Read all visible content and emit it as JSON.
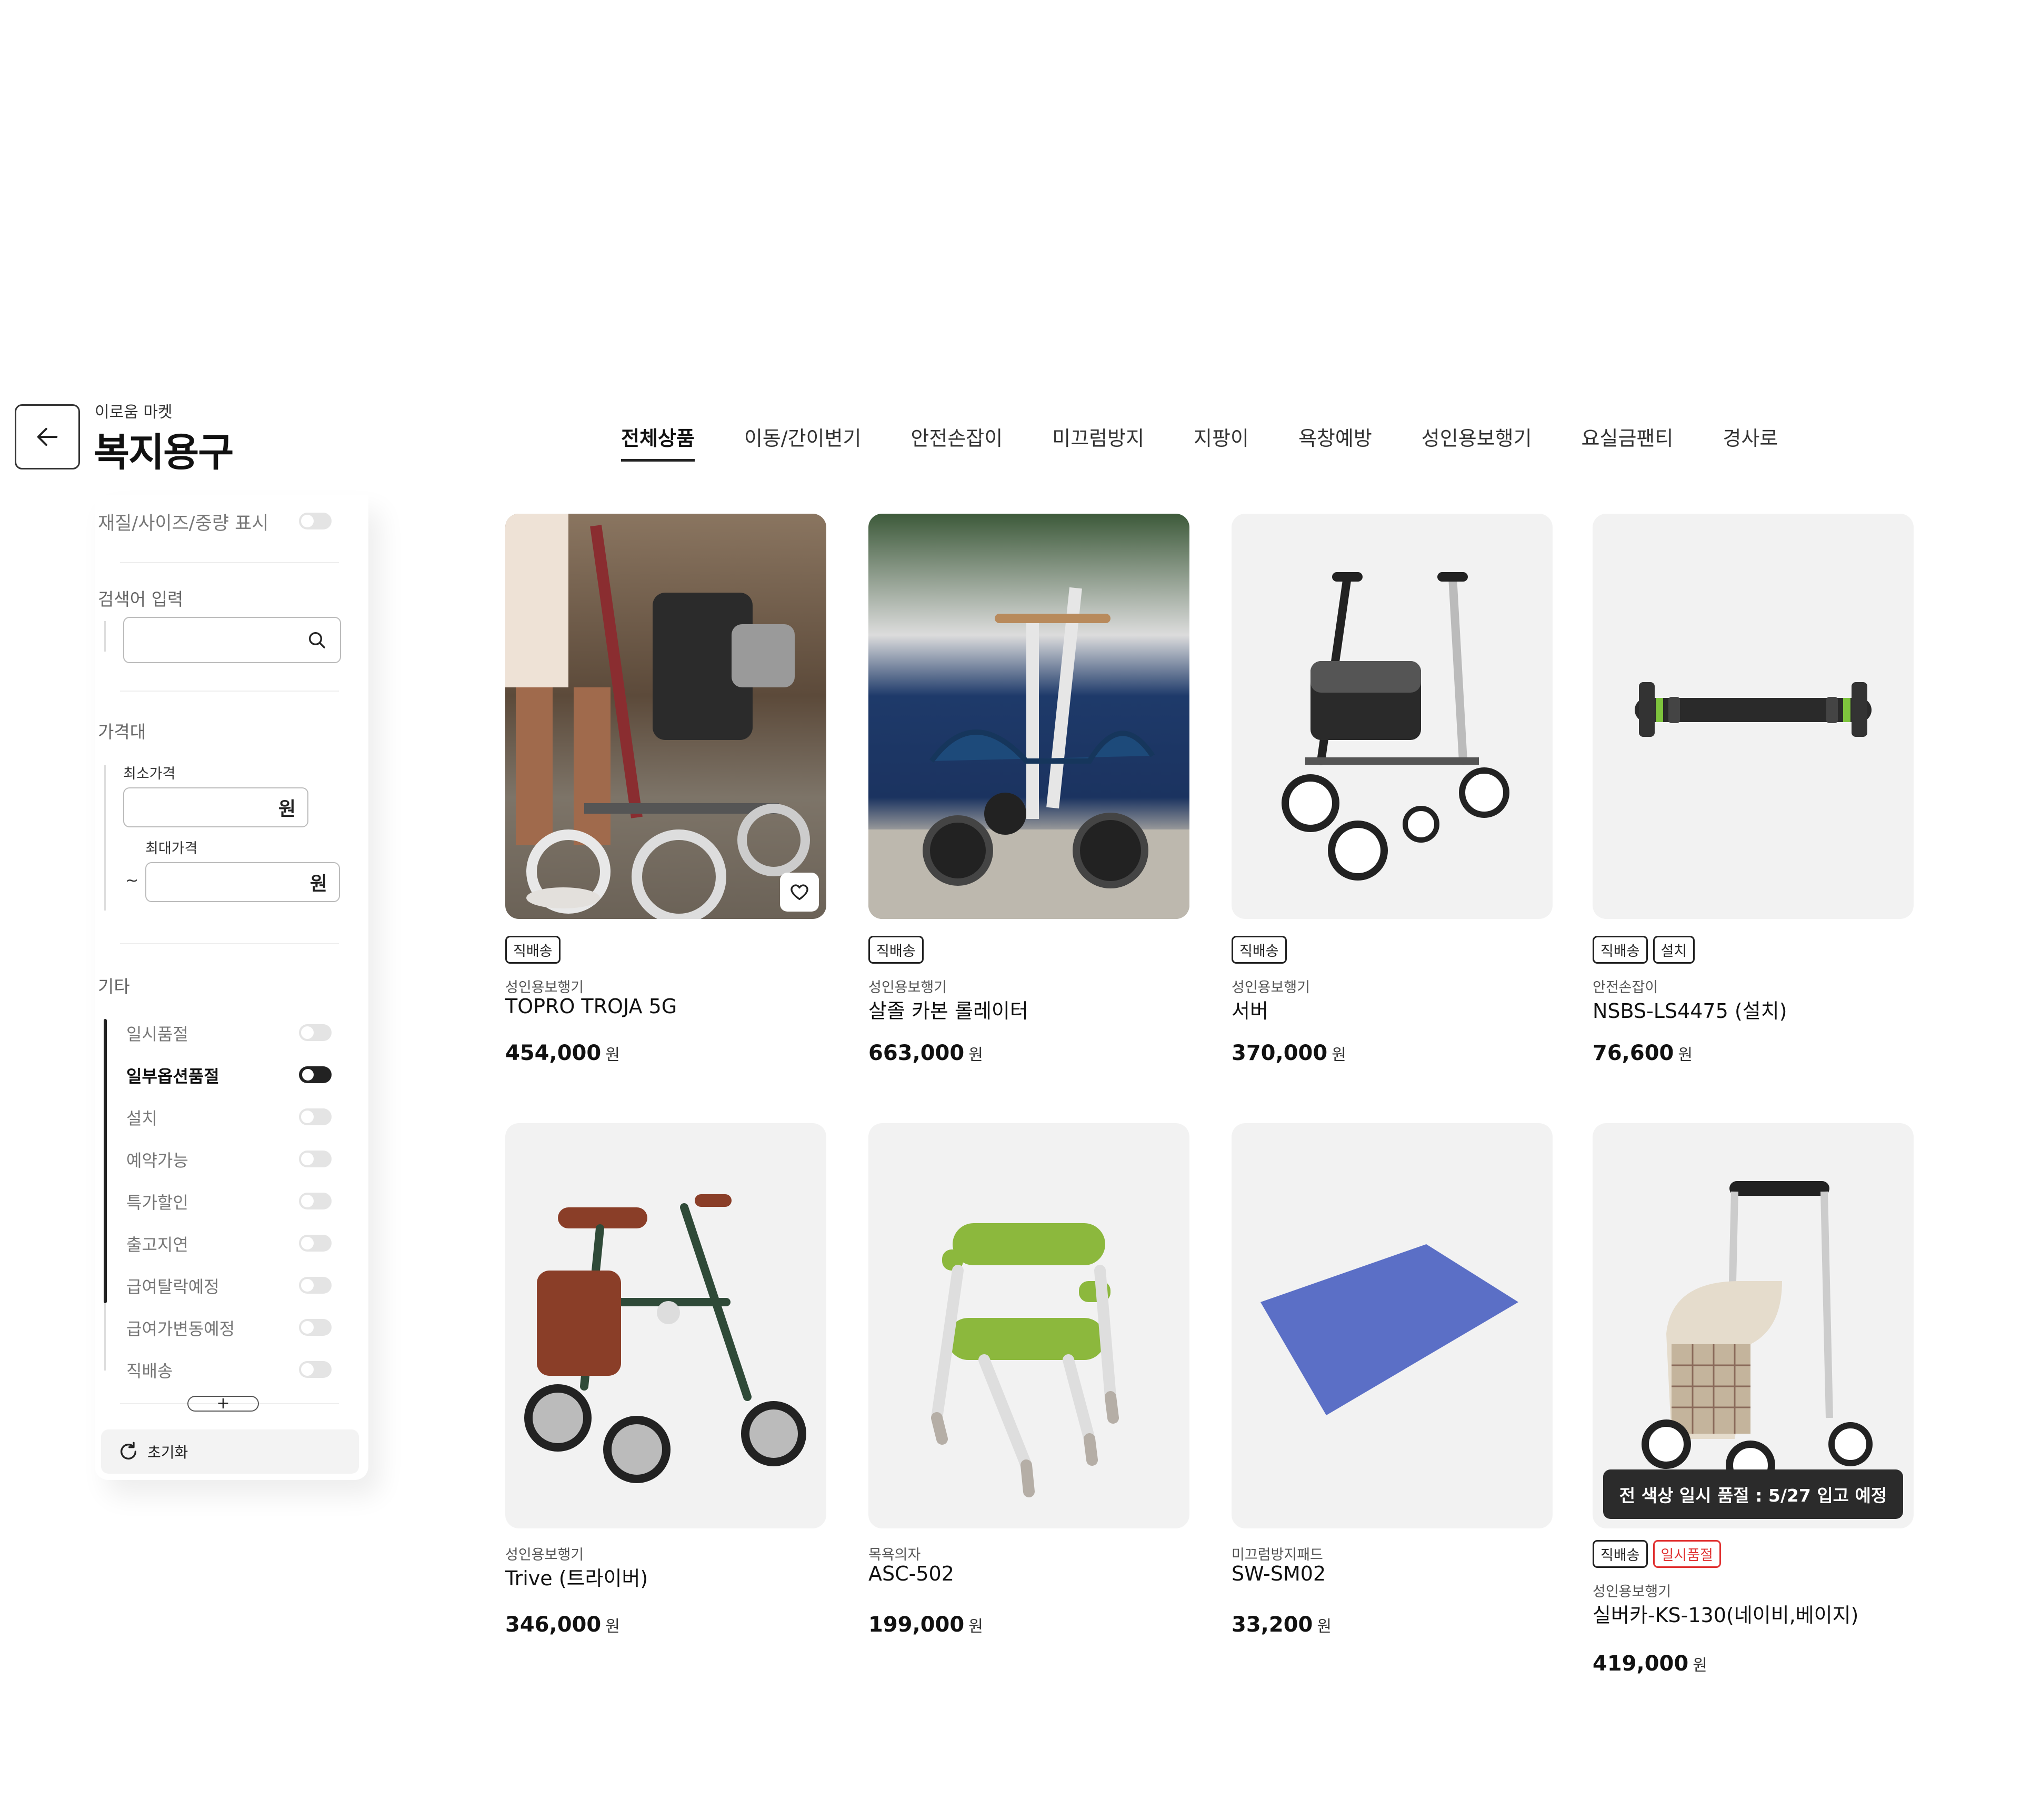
{
  "header": {
    "brand_sub": "이로움 마켓",
    "brand_title": "복지용구",
    "tabs": [
      "전체상품",
      "이동/간이변기",
      "안전손잡이",
      "미끄럼방지",
      "지팡이",
      "욕창예방",
      "성인용보행기",
      "요실금팬티",
      "경사로"
    ],
    "active_tab": "전체상품"
  },
  "sidebar": {
    "display_toggle_label": "재질/사이즈/중량 표시",
    "search": {
      "label": "검색어 입력",
      "value": "",
      "placeholder": ""
    },
    "price": {
      "label": "가격대",
      "min_label": "최소가격",
      "max_label": "최대가격",
      "unit": "원",
      "tilde": "~",
      "min_value": "",
      "max_value": ""
    },
    "etc": {
      "label": "기타",
      "items": [
        {
          "label": "일시품절",
          "on": false
        },
        {
          "label": "일부옵션품절",
          "on": true
        },
        {
          "label": "설치",
          "on": false
        },
        {
          "label": "예약가능",
          "on": false
        },
        {
          "label": "특가할인",
          "on": false
        },
        {
          "label": "출고지연",
          "on": false
        },
        {
          "label": "급여탈락예정",
          "on": false
        },
        {
          "label": "급여가변동예정",
          "on": false
        },
        {
          "label": "직배송",
          "on": false
        }
      ]
    },
    "more_label": "+",
    "reset_label": "초기화"
  },
  "products": [
    {
      "badges": [
        "직배송"
      ],
      "category": "성인용보행기",
      "name": "TOPRO TROJA 5G",
      "price": "454,000",
      "unit": "원",
      "image": "rollator-photo",
      "has_heart": true
    },
    {
      "badges": [
        "직배송"
      ],
      "category": "성인용보행기",
      "name": "살졸 카본 롤레이터",
      "price": "663,000",
      "unit": "원",
      "image": "rollator-blue-photo"
    },
    {
      "badges": [
        "직배송"
      ],
      "category": "성인용보행기",
      "name": "서버",
      "price": "370,000",
      "unit": "원",
      "image": "rollator-product"
    },
    {
      "badges": [
        "직배송",
        "설치"
      ],
      "category": "안전손잡이",
      "name": "NSBS-LS4475 (설치)",
      "price": "76,600",
      "unit": "원",
      "image": "grab-bar"
    },
    {
      "badges": [],
      "category": "성인용보행기",
      "name": "Trive (트라이버)",
      "price": "346,000",
      "unit": "원",
      "image": "rollator-green"
    },
    {
      "badges": [],
      "category": "목욕의자",
      "name": "ASC-502",
      "price": "199,000",
      "unit": "원",
      "image": "bath-chair"
    },
    {
      "badges": [],
      "category": "미끄럼방지패드",
      "name": "SW-SM02",
      "price": "33,200",
      "unit": "원",
      "image": "anti-slip-pad"
    },
    {
      "badges": [
        "직배송",
        "일시품절"
      ],
      "category": "성인용보행기",
      "name": "실버카-KS-130(네이비,베이지)",
      "price": "419,000",
      "unit": "원",
      "image": "silver-car",
      "banner": "전 색상 일시 품절 : 5/27 입고 예정"
    }
  ],
  "colors": {
    "text": "#222222",
    "muted": "#777777",
    "soldout_red": "#e03030",
    "card_bg": "#f2f2f2",
    "banner_bg": "#2b2b2b"
  }
}
